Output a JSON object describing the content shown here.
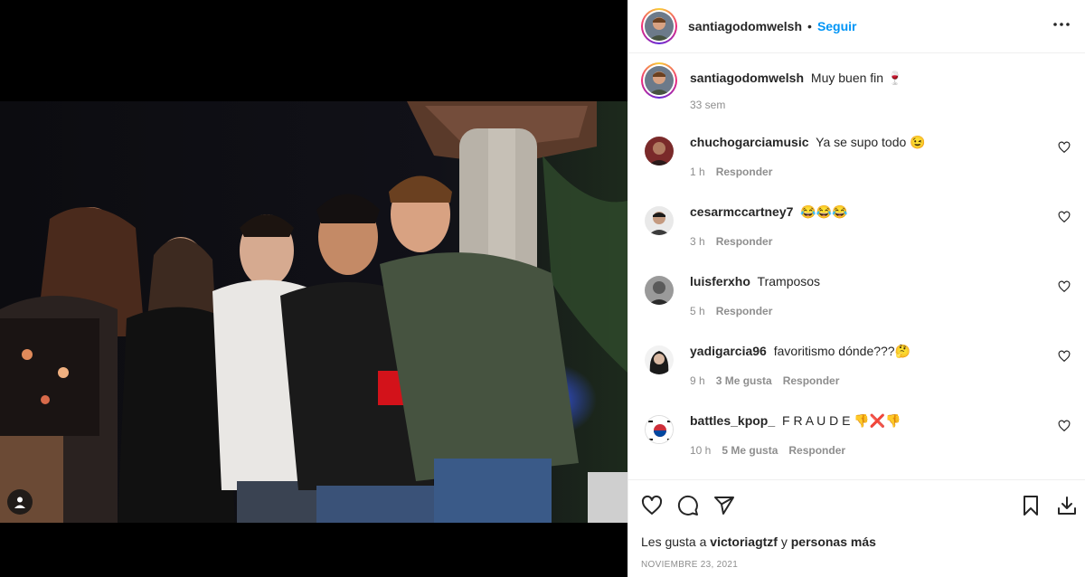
{
  "post": {
    "author": "santiagodomwelsh",
    "separator": "•",
    "follow_label": "Seguir",
    "more_label": "•••"
  },
  "caption": {
    "user": "santiagodomwelsh",
    "text": "Muy buen fin 🍷",
    "time": "33 sem"
  },
  "comments": [
    {
      "user": "chuchogarciamusic",
      "text": "Ya se supo todo 😉",
      "time": "1 h",
      "likes": "",
      "reply": "Responder",
      "avatar_color": "#7a2a2a"
    },
    {
      "user": "cesarmccartney7",
      "text": "😂😂😂",
      "time": "3 h",
      "likes": "",
      "reply": "Responder",
      "avatar_color": "#3b3b3b"
    },
    {
      "user": "luisferxho",
      "text": "Tramposos",
      "time": "5 h",
      "likes": "",
      "reply": "Responder",
      "avatar_color": "#4a4a4a"
    },
    {
      "user": "yadigarcia96",
      "text": "favoritismo dónde???🤔",
      "time": "9 h",
      "likes": "3 Me gusta",
      "reply": "Responder",
      "avatar_color": "#2b2b2b"
    },
    {
      "user": "battles_kpop_",
      "text": "F R A U D E 👎❌👎",
      "time": "10 h",
      "likes": "5 Me gusta",
      "reply": "Responder",
      "avatar_color": "#ffffff"
    }
  ],
  "likes_line": {
    "prefix": "Les gusta a",
    "user": "victoriagtzf",
    "mid": "y",
    "rest": "personas más"
  },
  "date": "NOVIEMBRE 23, 2021",
  "colors": {
    "accent": "#0095f6",
    "meta": "#8e8e8e",
    "border": "#efefef"
  },
  "icons": [
    "heart-icon",
    "comment-icon",
    "share-icon",
    "bookmark-icon",
    "download-icon",
    "user-tag-icon",
    "more-icon"
  ]
}
